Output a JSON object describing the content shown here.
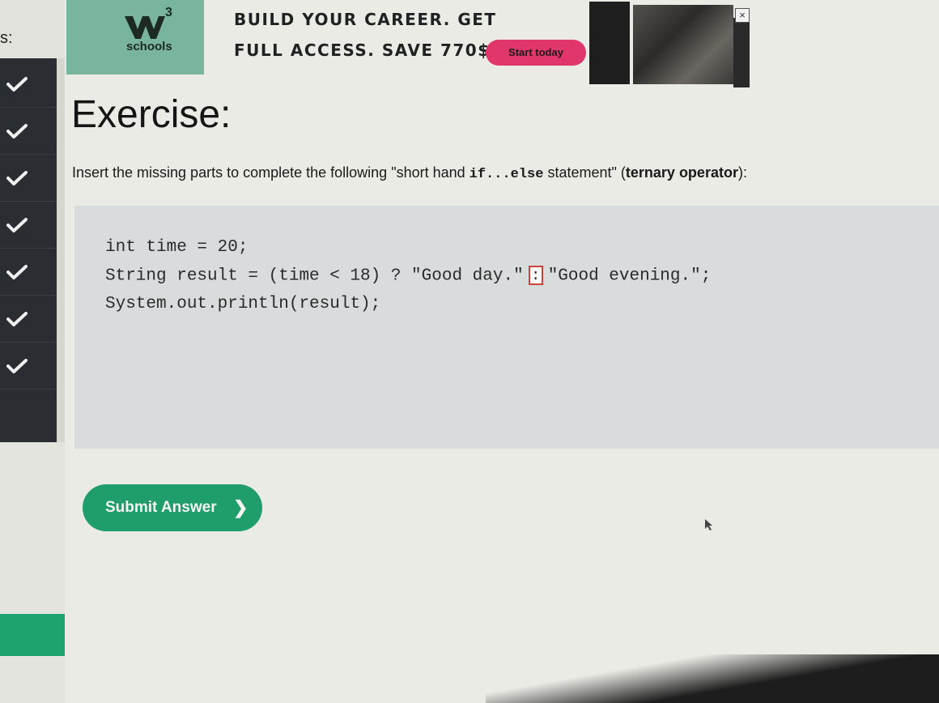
{
  "sidebar": {
    "heading_fragment": "s:",
    "completed_items": 7
  },
  "ad": {
    "logo_superscript": "3",
    "logo_text": "schools",
    "headline_1": "BUILD YOUR CAREER. GET",
    "headline_2": "FULL ACCESS. SAVE 770$",
    "cta_label": "Start today",
    "close_label": "×",
    "colors": {
      "logo_bg": "#79b49e",
      "cta_bg": "#e0366b"
    }
  },
  "exercise": {
    "title": "Exercise:",
    "instructions_prefix": "Insert the missing parts to complete the following \"short hand ",
    "instructions_code": "if...else",
    "instructions_mid": " statement\" (",
    "instructions_bold": "ternary operator",
    "instructions_suffix": "):",
    "code": {
      "line_1": "int time = 20;",
      "line_2_before": "String result = (time < 18) ? \"Good day.\"",
      "answer_value": ":",
      "line_2_after": "\"Good evening.\";",
      "line_3": "System.out.println(result);"
    },
    "submit_label": "Submit Answer",
    "submit_chevron": "❯",
    "colors": {
      "accent": "#1f9d6b",
      "input_border": "#d0433a",
      "code_bg": "#d9dcdc"
    }
  }
}
